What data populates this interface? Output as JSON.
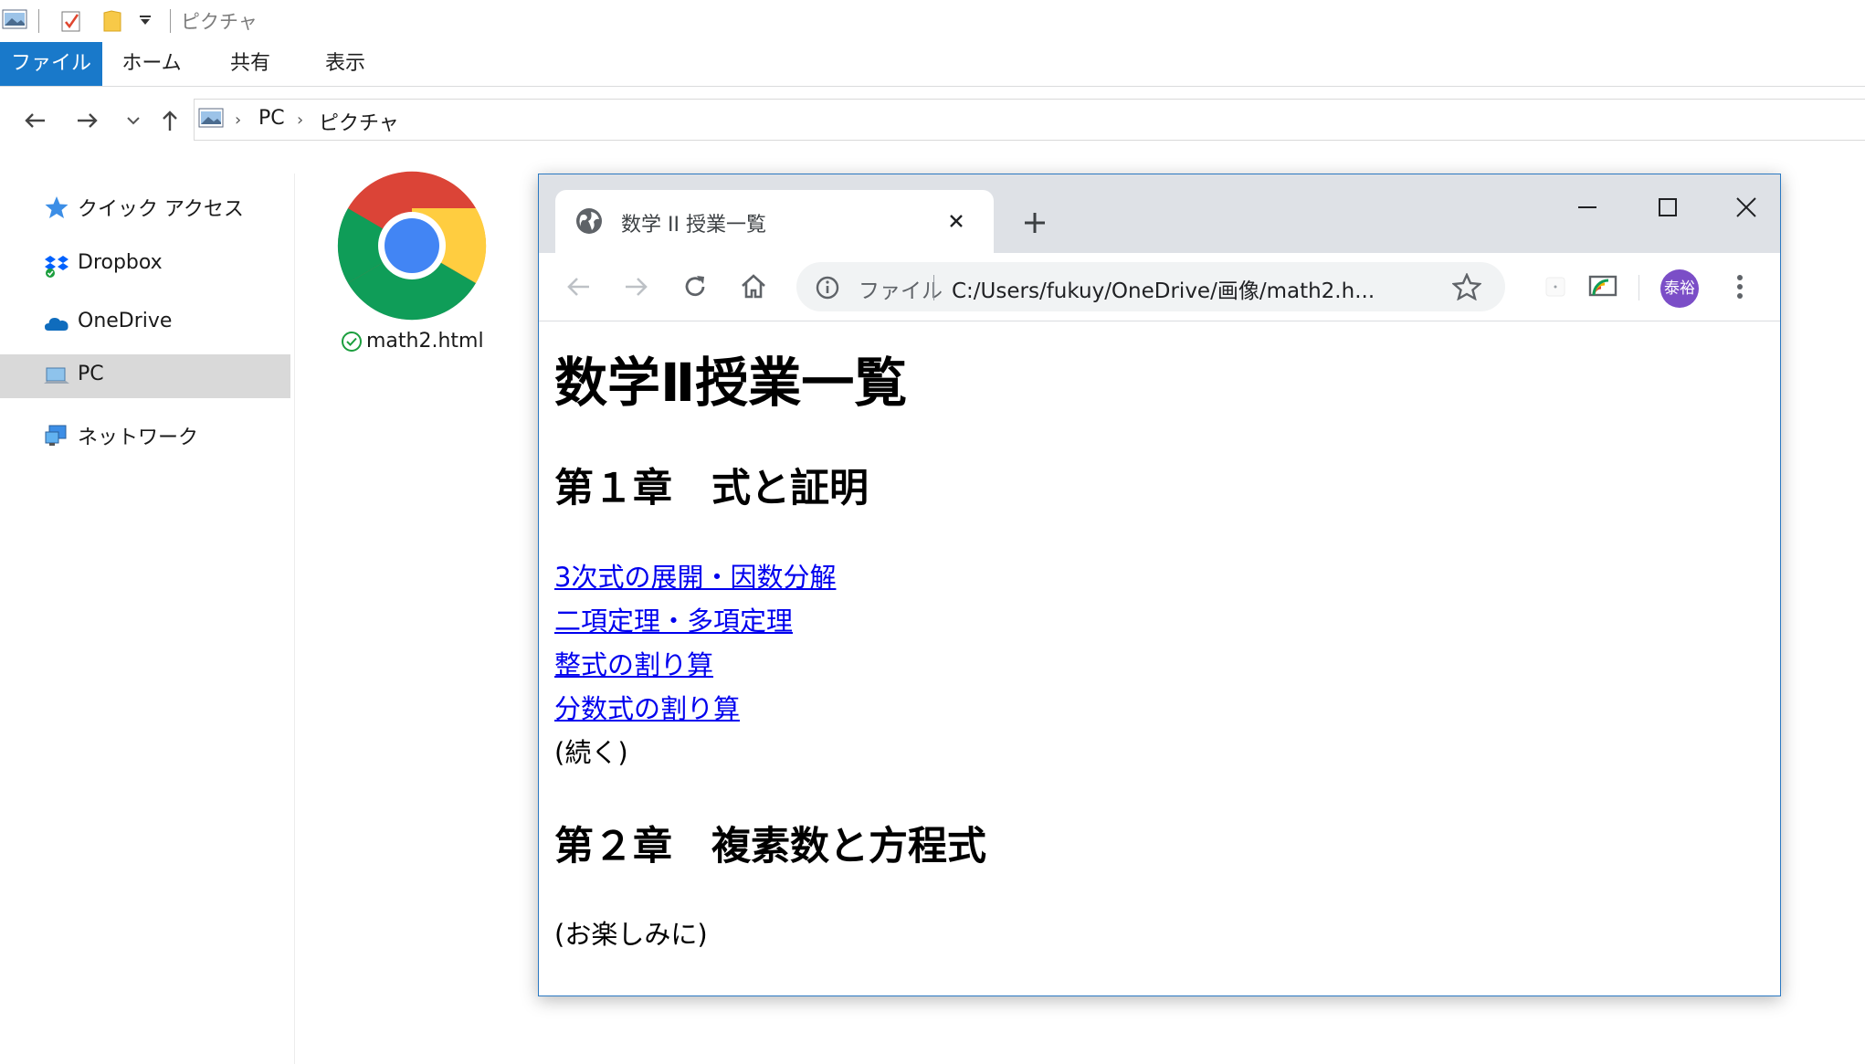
{
  "explorer": {
    "title": "ピクチャ",
    "ribbon_tabs": [
      "ファイル",
      "ホーム",
      "共有",
      "表示"
    ],
    "breadcrumb": [
      "PC",
      "ピクチャ"
    ],
    "nav_items": [
      {
        "label": "クイック アクセス",
        "icon": "star-icon"
      },
      {
        "label": "Dropbox",
        "icon": "dropbox-icon"
      },
      {
        "label": "OneDrive",
        "icon": "onedrive-icon"
      },
      {
        "label": "PC",
        "icon": "pc-icon",
        "selected": true
      },
      {
        "label": "ネットワーク",
        "icon": "network-icon"
      }
    ],
    "file": {
      "name": "math2.html",
      "icon": "chrome-icon",
      "sync_status": "synced"
    }
  },
  "browser": {
    "tab_title": "数学 II 授業一覧",
    "omnibox": {
      "scheme_label": "ファイル",
      "url": "C:/Users/fukuy/OneDrive/画像/math2.h..."
    },
    "avatar_text": "泰裕",
    "page": {
      "title": "数学Ⅱ授業一覧",
      "chapters": [
        {
          "heading": "第１章　式と証明",
          "links": [
            "3次式の展開・因数分解",
            "二項定理・多項定理",
            "整式の割り算",
            "分数式の割り算"
          ],
          "note": "(続く)"
        },
        {
          "heading": "第２章　複素数と方程式",
          "links": [],
          "note": "(お楽しみに)"
        }
      ]
    }
  },
  "colors": {
    "ribbon_file_tab": "#1979ca",
    "link": "#0000ee",
    "window_border": "#2b79c2",
    "avatar": "#7b4ec7"
  }
}
